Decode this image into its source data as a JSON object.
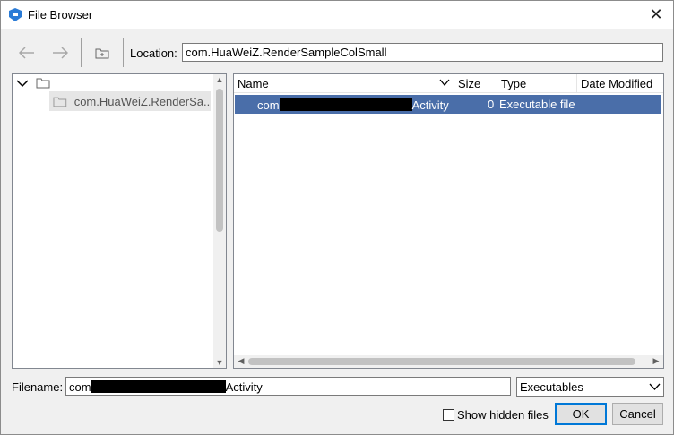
{
  "window": {
    "title": "File Browser",
    "app_icon": "app-logo-icon",
    "close_icon": "close-icon"
  },
  "toolbar": {
    "back_icon": "arrow-left-icon",
    "forward_icon": "arrow-right-icon",
    "new_folder_icon": "folder-icon",
    "location_label": "Location:",
    "location_value": "com.HuaWeiZ.RenderSampleColSmall"
  },
  "tree": {
    "root_icon": "folder-icon",
    "items": [
      {
        "label": "com.HuaWeiZ.RenderSa..."
      }
    ]
  },
  "list": {
    "columns": [
      "Name",
      "Size",
      "Type",
      "Date Modified"
    ],
    "rows": [
      {
        "name_prefix": "com",
        "name_suffix": "Activity",
        "size": "0",
        "type": "Executable file",
        "date": "",
        "selected": true
      }
    ]
  },
  "footer": {
    "filename_label": "Filename:",
    "filename_prefix": "com",
    "filename_suffix": "Activity",
    "filter_value": "Executables",
    "show_hidden_label": "Show hidden files",
    "show_hidden_checked": false,
    "ok_label": "OK",
    "cancel_label": "Cancel"
  },
  "colors": {
    "selection": "#4a6ea9",
    "accent": "#0078d7"
  }
}
